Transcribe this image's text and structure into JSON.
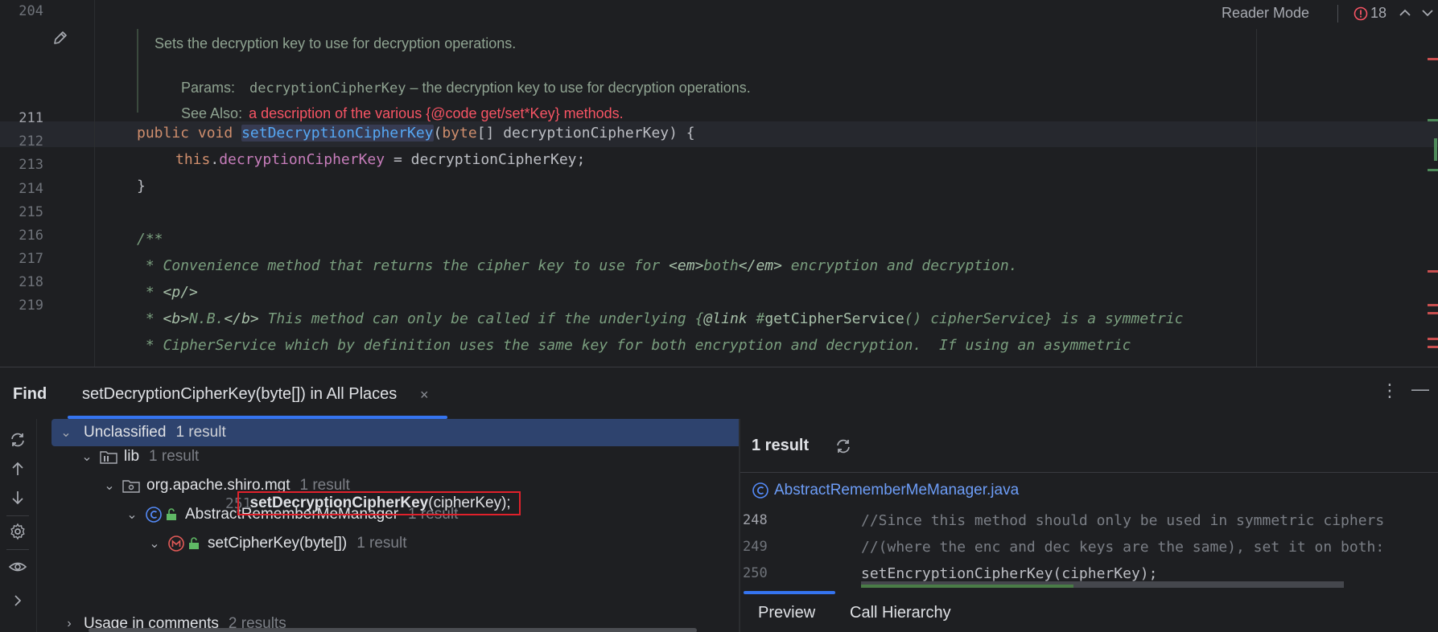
{
  "editor": {
    "line_numbers": [
      "204",
      "211",
      "212",
      "213",
      "214",
      "215",
      "216",
      "217",
      "218",
      "219"
    ],
    "reader_mode": "Reader Mode",
    "error_count": "18",
    "doc": {
      "summary": "Sets the decryption key to use for decryption operations.",
      "params_label": "Params:",
      "param_name": "decryptionCipherKey",
      "param_desc": " – the decryption key to use for decryption operations.",
      "see_also_label": "See Also:",
      "see_also_text": "a description of the various {@code get/set*Key} methods."
    },
    "code": {
      "l211_kw1": "public",
      "l211_kw2": "void",
      "l211_fn": "setDecryptionCipherKey",
      "l211_paren": "(",
      "l211_type": "byte",
      "l211_rest": "[] decryptionCipherKey) {",
      "l212_this": "this",
      "l212_dot": ".",
      "l212_field": "decryptionCipherKey",
      "l212_rest": " = decryptionCipherKey;",
      "l213": "}",
      "l215": "/**",
      "l216_a": " * Convenience method that returns the cipher key to use for ",
      "l216_tag1": "<em>",
      "l216_b": "both",
      "l216_tag2": "</em>",
      "l216_c": " encryption and decryption.",
      "l217_a": " * ",
      "l217_tag": "<p/>",
      "l218_a": " * ",
      "l218_tag1": "<b>",
      "l218_b": "N.B.",
      "l218_tag2": "</b>",
      "l218_c": " This method can only be called if the underlying {",
      "l218_link": "@link",
      "l218_d": " #",
      "l218_ref": "getCipherService",
      "l218_e": "() cipherService} is a symmetric",
      "l219": " * CipherService which by definition uses the same key for both encryption and decryption.  If using an asymmetric"
    }
  },
  "find": {
    "title": "Find",
    "tab_label": "setDecryptionCipherKey(byte[]) in All Places",
    "tab_close": "×",
    "more": "⋮",
    "minimize": "—",
    "tree": {
      "unclassified": {
        "label": "Unclassified",
        "count": "1 result"
      },
      "lib": {
        "label": "lib",
        "count": "1 result"
      },
      "package": {
        "label": "org.apache.shiro.mgt",
        "count": "1 result"
      },
      "class": {
        "label": "AbstractRememberMeManager",
        "count": "1 result"
      },
      "method": {
        "label": "setCipherKey(byte[])",
        "count": "1 result"
      },
      "usage": {
        "line": "251",
        "bold": "setDecryptionCipherKey",
        "rest": "(cipherKey);"
      },
      "comments": {
        "label": "Usage in comments",
        "count": "2 results"
      }
    },
    "preview": {
      "count": "1 result",
      "file": "AbstractRememberMeManager.java",
      "lines": [
        {
          "n": "248",
          "code": "//Since this method should only be used in symmetric ciphers"
        },
        {
          "n": "249",
          "code": "//(where the enc and dec keys are the same), set it on both:"
        },
        {
          "n": "250",
          "code": "setEncryptionCipherKey(cipherKey);"
        }
      ],
      "tabs": [
        "Preview",
        "Call Hierarchy"
      ]
    }
  },
  "colors": {
    "accent": "#3574f0",
    "selection": "#2e436e",
    "error": "#f75464",
    "highlight_box": "#e0212b"
  }
}
